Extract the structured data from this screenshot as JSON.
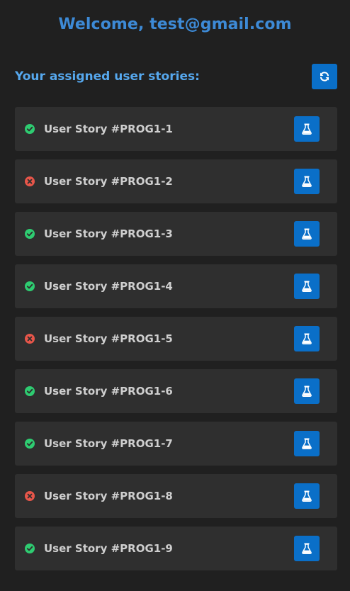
{
  "header": {
    "welcome": "Welcome, test@gmail.com"
  },
  "section": {
    "title": "Your assigned user stories:",
    "refresh_icon": "refresh-icon"
  },
  "colors": {
    "passed": "#2ecc71",
    "failed": "#e8564a",
    "accent": "#0a6fc8",
    "title": "#3d8ad6"
  },
  "stories": [
    {
      "label": "User Story #PROG1-1",
      "status": "passed"
    },
    {
      "label": "User Story #PROG1-2",
      "status": "failed"
    },
    {
      "label": "User Story #PROG1-3",
      "status": "passed"
    },
    {
      "label": "User Story #PROG1-4",
      "status": "passed"
    },
    {
      "label": "User Story #PROG1-5",
      "status": "failed"
    },
    {
      "label": "User Story #PROG1-6",
      "status": "passed"
    },
    {
      "label": "User Story #PROG1-7",
      "status": "passed"
    },
    {
      "label": "User Story #PROG1-8",
      "status": "failed"
    },
    {
      "label": "User Story #PROG1-9",
      "status": "passed"
    }
  ]
}
